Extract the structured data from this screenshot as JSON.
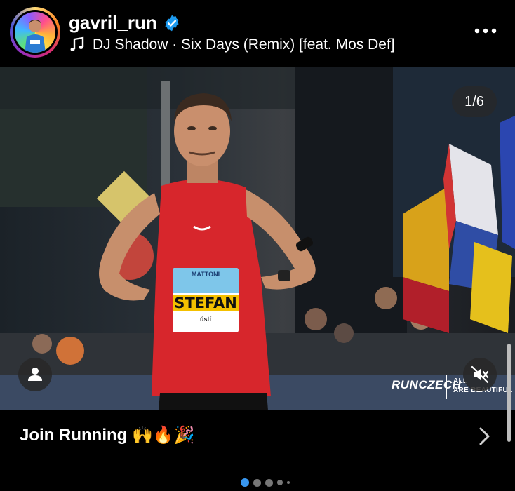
{
  "post": {
    "username": "gavril_run",
    "verified_icon": "verified-badge-icon",
    "audio": "DJ Shadow · Six Days (Remix) [feat. Mos Def]",
    "more_icon": "more-options-icon"
  },
  "media": {
    "counter": "1/6",
    "bib_brand": "MATTONI",
    "bib_name": "STEFAN",
    "bib_sponsor": "ústí",
    "watermark_brand": "RUNCZECH",
    "watermark_tag_line1": "ALL",
    "watermark_tag_line2": "ARE BEAUTIFUL",
    "tag_icon": "person-tag-icon",
    "mute_icon": "muted-speaker-icon"
  },
  "cta": {
    "label": "Join Running 🙌🔥🎉",
    "arrow_icon": "chevron-right-icon"
  },
  "carousel": {
    "total_dots": 5,
    "active_index": 0
  },
  "colors": {
    "accent_blue": "#3897f0",
    "verified_blue": "#1d9bf0",
    "singlet_red": "#d7262c"
  }
}
